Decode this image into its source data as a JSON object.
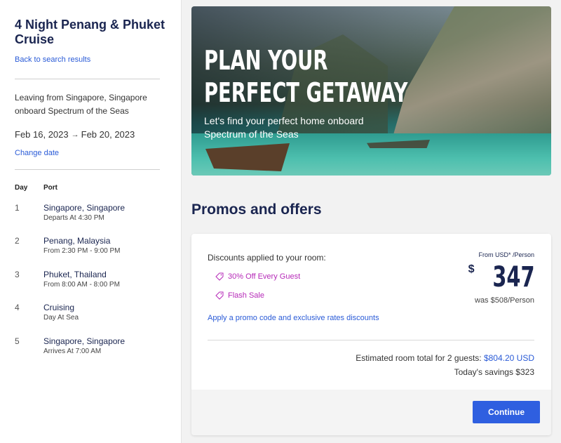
{
  "sidebar": {
    "cruise_title": "4 Night Penang & Phuket Cruise",
    "back_link": "Back to search results",
    "leaving_text": "Leaving from Singapore, Singapore onboard Spectrum of the Seas",
    "date_start": "Feb 16, 2023",
    "date_end": "Feb 20, 2023",
    "change_date": "Change date",
    "itinerary_headers": {
      "day": "Day",
      "port": "Port"
    },
    "itinerary": [
      {
        "day": "1",
        "port": "Singapore, Singapore",
        "detail": "Departs At 4:30 PM"
      },
      {
        "day": "2",
        "port": "Penang, Malaysia",
        "detail": "From 2:30 PM - 9:00 PM"
      },
      {
        "day": "3",
        "port": "Phuket, Thailand",
        "detail": "From 8:00 AM - 8:00 PM"
      },
      {
        "day": "4",
        "port": "Cruising",
        "detail": "Day At Sea"
      },
      {
        "day": "5",
        "port": "Singapore, Singapore",
        "detail": "Arrives At 7:00 AM"
      }
    ]
  },
  "hero": {
    "headline_line1": "PLAN YOUR",
    "headline_line2": "PERFECT GETAWAY",
    "subtext": "Let's find your perfect home onboard Spectrum of the Seas"
  },
  "promos": {
    "title": "Promos and offers",
    "discounts_label": "Discounts applied to your room:",
    "tags": [
      "30% Off Every Guest",
      "Flash Sale"
    ],
    "promo_link": "Apply a promo code and exclusive rates discounts",
    "from_label": "From USD* /Person",
    "price_currency": "$",
    "price_amount": "347",
    "was_price": "was $508/Person",
    "estimate_label": "Estimated room total for 2 guests: ",
    "estimate_value": "$804.20 USD",
    "savings": "Today's savings $323",
    "continue_label": "Continue"
  },
  "colors": {
    "navy": "#1a2550",
    "link_blue": "#2a5bd7",
    "promo_purple": "#b62ab8",
    "button_blue": "#2f5fe0"
  }
}
